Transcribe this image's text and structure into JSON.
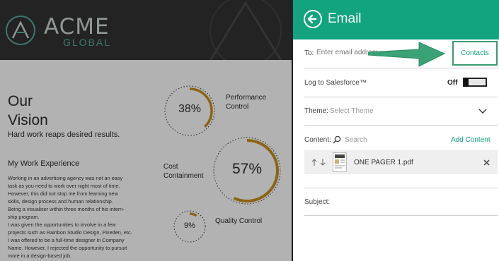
{
  "document": {
    "logo_name": "ACME",
    "logo_sub": "GLOBAL",
    "vision_line1": "Our",
    "vision_line2": "Vision",
    "tagline": "Hard work reaps desired results.",
    "experience_title": "My Work Experience",
    "experience_lines": [
      "Working in an advertising agency was not an easy",
      "task as you need to work over night most of time.",
      "However, this did not stop me from learning new",
      "skills, design process and human relationship.",
      "Being a visualiser within three months of his intern-",
      "ship program.",
      "I was given the opportunities to involve in a few",
      "projects such as Rainbon Studio Design, Pixeden, etc.",
      "I was offered to be a full-time designer in Company",
      "Name. However, I rejected the opportunity to pursuit",
      "more in a design-based job."
    ],
    "stats": [
      {
        "label_line1": "Performance",
        "label_line2": "Control",
        "value_text": "38%",
        "fraction": 0.38
      },
      {
        "label_line1": "Cost",
        "label_line2": "Containment",
        "value_text": "57%",
        "fraction": 0.57
      },
      {
        "label_line1": "Quality Control",
        "label_line2": "",
        "value_text": "9%",
        "fraction": 0.09
      }
    ],
    "accent_color": "#c8901e"
  },
  "panel": {
    "title": "Email",
    "to_label": "To:",
    "to_placeholder": "Enter email address",
    "contacts_label": "Contacts",
    "log_label": "Log to Salesforce™",
    "log_state": "Off",
    "theme_label": "Theme:",
    "theme_value": "Select Theme",
    "content_label": "Content:",
    "search_placeholder": "Search",
    "add_content_label": "Add Content",
    "attachment_name": "ONE PAGER 1.pdf",
    "subject_label": "Subject:",
    "brand_color": "#12a37f"
  }
}
